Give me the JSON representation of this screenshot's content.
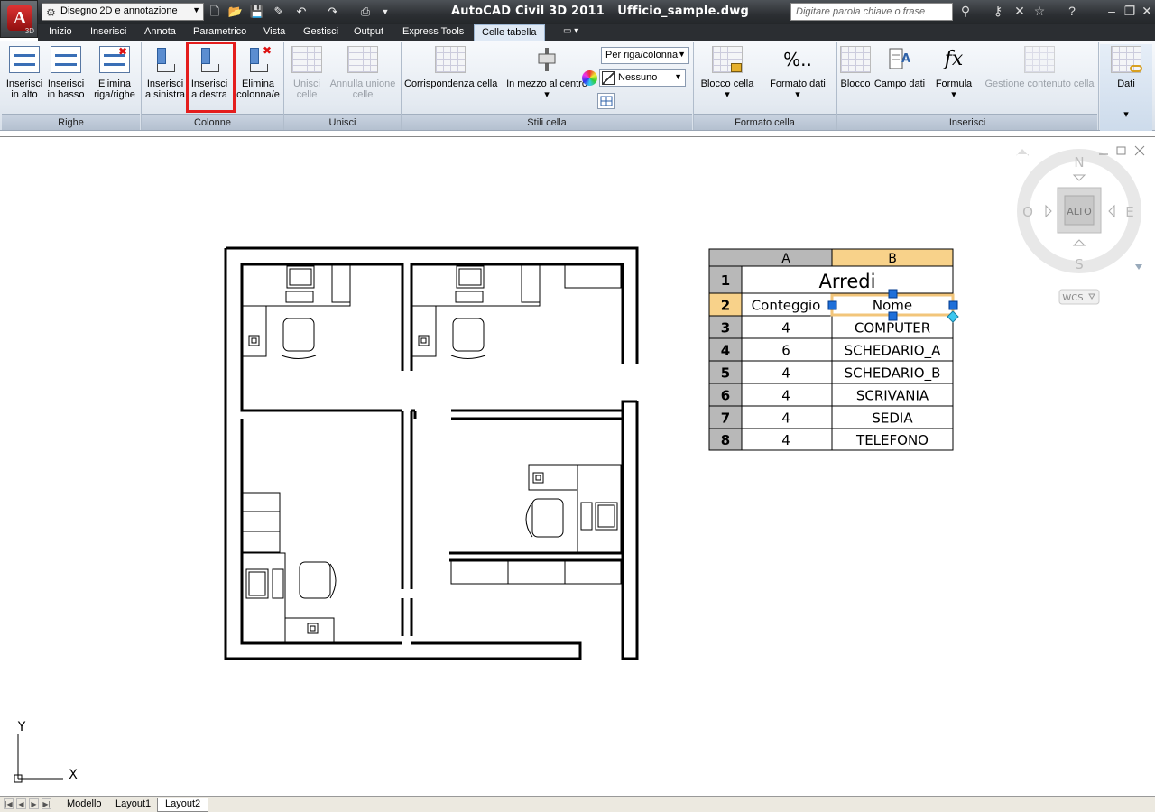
{
  "titlebar": {
    "workspace": "Disegno 2D e annotazione",
    "title": "AutoCAD Civil 3D 2011",
    "filename": "Ufficio_sample.dwg",
    "search_placeholder": "Digitare parola chiave o frase",
    "app_tag": "3D"
  },
  "menu": {
    "items": [
      "Inizio",
      "Inserisci",
      "Annota",
      "Parametrico",
      "Vista",
      "Gestisci",
      "Output",
      "Express Tools",
      "Celle tabella"
    ],
    "active": "Celle tabella"
  },
  "ribbon": {
    "panels": {
      "righe": "Righe",
      "colonne": "Colonne",
      "unisci": "Unisci",
      "stili": "Stili cella",
      "formato": "Formato cella",
      "inserisci": "Inserisci"
    },
    "buttons": {
      "ins_alto": [
        "Inserisci",
        "in alto"
      ],
      "ins_basso": [
        "Inserisci",
        "in basso"
      ],
      "elim_righe": [
        "Elimina",
        "riga/righe"
      ],
      "ins_sx": [
        "Inserisci",
        "a sinistra"
      ],
      "ins_dx": [
        "Inserisci",
        "a destra"
      ],
      "elim_col": [
        "Elimina",
        "colonna/e"
      ],
      "unisci_celle": [
        "Unisci",
        "celle"
      ],
      "annulla_unione": [
        "Annulla unione",
        "celle"
      ],
      "corrispondenza": "Corrispondenza cella",
      "mezzo_centro": "In mezzo al centro",
      "blocco_cella": "Blocco cella",
      "formato_dati": "Formato dati",
      "blocco": "Blocco",
      "campo_dati": "Campo dati",
      "formula": "Formula",
      "gestione": "Gestione contenuto cella",
      "dati": "Dati"
    },
    "controls": {
      "per_riga": "Per riga/colonna",
      "nessuno": "Nessuno"
    }
  },
  "table": {
    "col_headers": [
      "A",
      "B"
    ],
    "title": "Arredi",
    "header": [
      "Conteggio",
      "Nome"
    ],
    "rows": [
      [
        "4",
        "COMPUTER"
      ],
      [
        "6",
        "SCHEDARIO_A"
      ],
      [
        "4",
        "SCHEDARIO_B"
      ],
      [
        "4",
        "SCRIVANIA"
      ],
      [
        "4",
        "SEDIA"
      ],
      [
        "4",
        "TELEFONO"
      ]
    ],
    "row_numbers": [
      "1",
      "2",
      "3",
      "4",
      "5",
      "6",
      "7",
      "8"
    ]
  },
  "viewcube": {
    "n": "N",
    "s": "S",
    "e": "E",
    "o": "O",
    "face": "ALTO",
    "wcs": "WCS"
  },
  "ucs": {
    "x": "X",
    "y": "Y"
  },
  "layout_tabs": {
    "items": [
      "Modello",
      "Layout1",
      "Layout2"
    ],
    "active": "Layout2"
  },
  "colors": {
    "selected": "#f8d28a",
    "header_gray": "#b8b8b8",
    "grip": "#1e6fd9",
    "highlight": "#e41d1d"
  }
}
